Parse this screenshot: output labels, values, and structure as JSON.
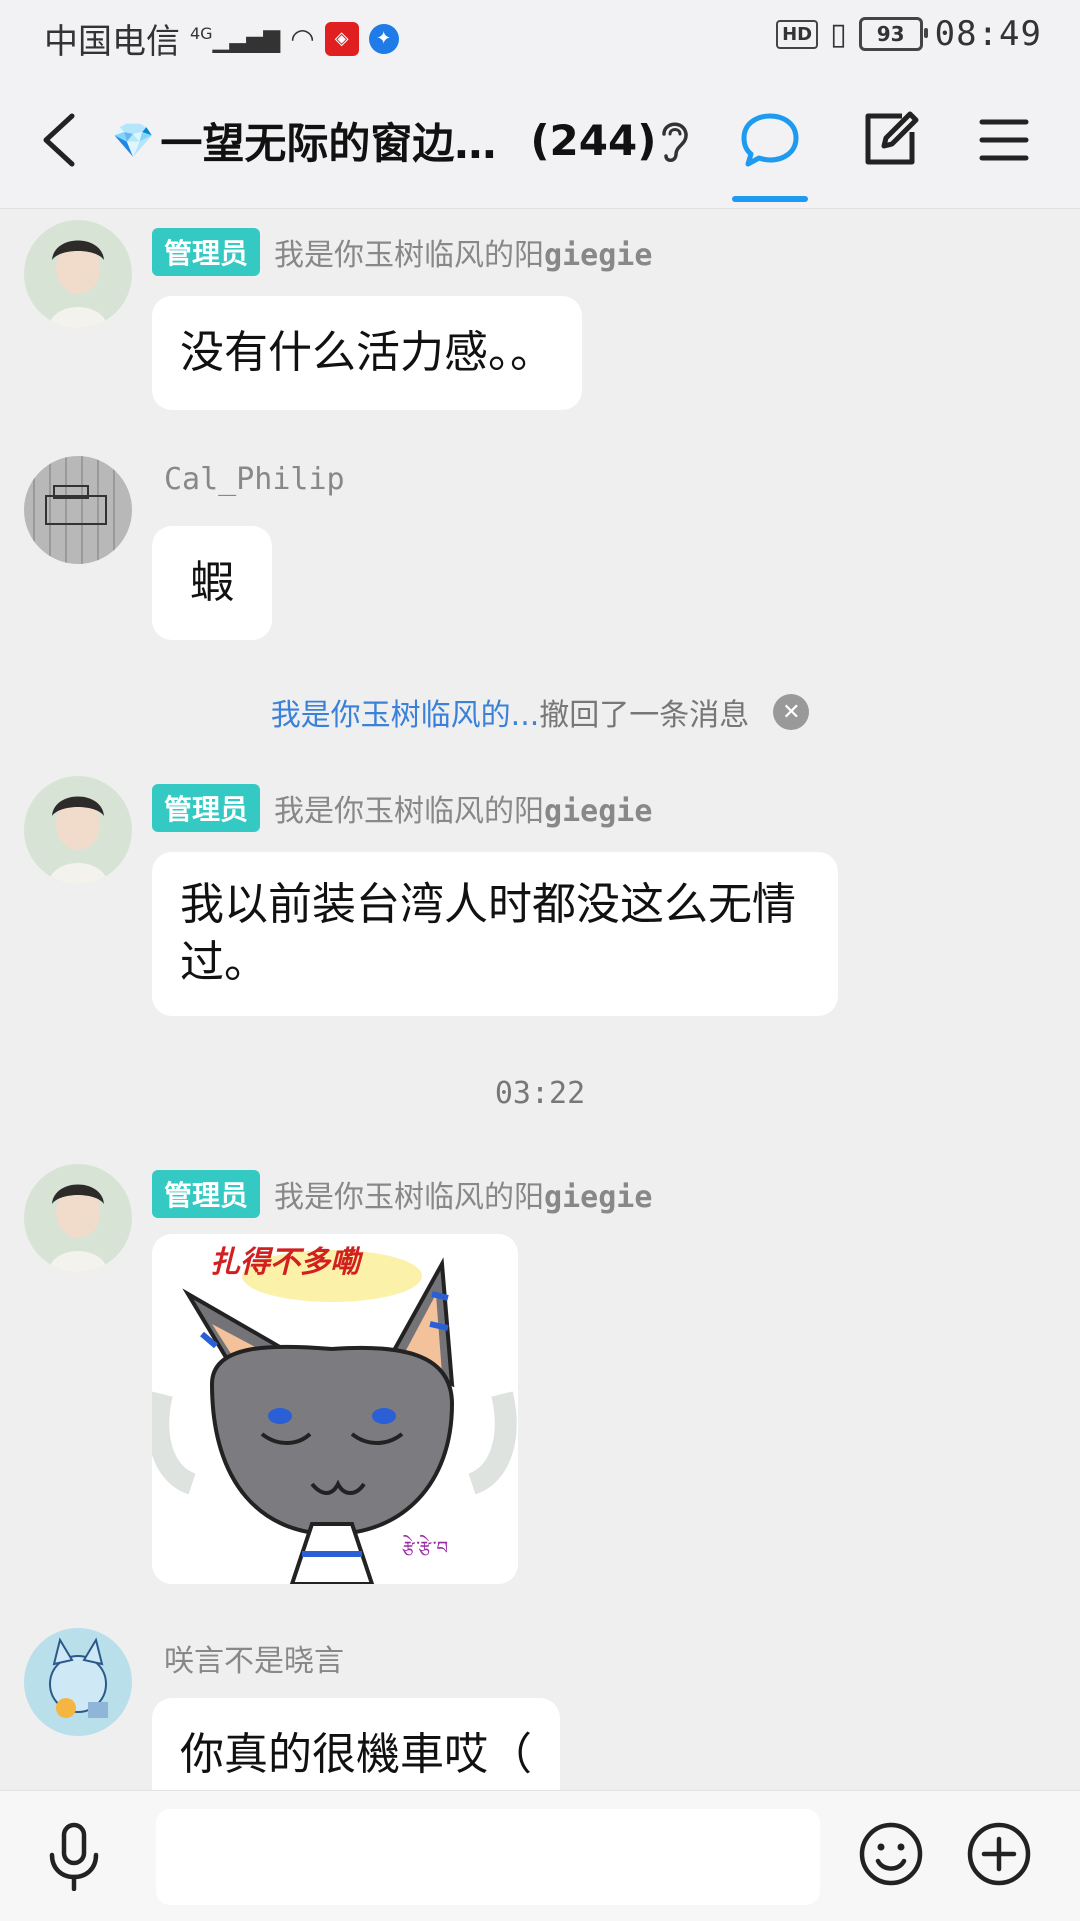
{
  "status_bar": {
    "carrier": "中国电信",
    "network": "4G",
    "battery": "93",
    "time": "08:49",
    "hd": "HD"
  },
  "header": {
    "title_emoji": "💎",
    "title": "一望无际的窗边…",
    "member_count": "(244)"
  },
  "messages": [
    {
      "tag": "管理员",
      "sender": "我是你玉树临风的阳",
      "sender_suffix": "giegie",
      "text": "没有什么活力感。。"
    },
    {
      "sender": "Cal_Philip",
      "text": "蝦"
    },
    {
      "tag": "管理员",
      "sender": "我是你玉树临风的阳",
      "sender_suffix": "giegie",
      "text_line1": "我以前装台湾人时都没这么无情",
      "text_line2": "过。"
    },
    {
      "tag": "管理员",
      "sender": "我是你玉树临风的阳",
      "sender_suffix": "giegie",
      "sticker_caption": "扎得不多嘞",
      "sticker_mark": "རྩེ་རྩེ་བ"
    },
    {
      "sender": "咲言不是晓言",
      "text": "你真的很機車哎（"
    }
  ],
  "recall": {
    "who": "我是你玉树临风的...",
    "text": "撤回了一条消息"
  },
  "timestamp": "03:22",
  "input": {
    "placeholder": ""
  },
  "colors": {
    "admin_tag": "#35c9c3",
    "accent": "#1e9bf0",
    "recall_link": "#3a82d9"
  }
}
